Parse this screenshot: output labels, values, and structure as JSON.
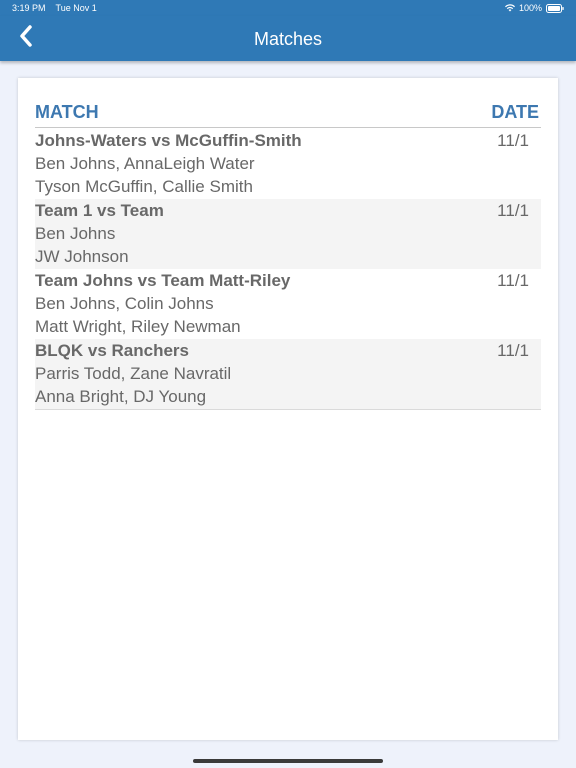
{
  "status_bar": {
    "time": "3:19 PM",
    "date": "Tue Nov 1",
    "battery": "100%",
    "icons": [
      "wifi-icon",
      "battery-icon"
    ]
  },
  "nav": {
    "title": "Matches",
    "back_icon": "chevron-left-icon"
  },
  "colors": {
    "nav_bg": "#2f79b6",
    "header_text": "#3d78b0",
    "row_text": "#686868",
    "alt_row_bg": "#f4f4f4",
    "page_bg": "#eef2fb"
  },
  "table": {
    "headers": {
      "match": "MATCH",
      "date": "DATE"
    },
    "rows": [
      {
        "title": "Johns-Waters vs McGuffin-Smith",
        "team1": "Ben Johns, AnnaLeigh Water",
        "team2": "Tyson McGuffin, Callie Smith",
        "date": "11/1"
      },
      {
        "title": "Team 1 vs Team",
        "team1": "Ben Johns",
        "team2": "JW Johnson",
        "date": "11/1"
      },
      {
        "title": "Team Johns vs Team Matt-Riley",
        "team1": "Ben Johns, Colin Johns",
        "team2": "Matt Wright, Riley Newman",
        "date": "11/1"
      },
      {
        "title": "BLQK vs Ranchers",
        "team1": "Parris Todd, Zane Navratil",
        "team2": "Anna Bright, DJ Young",
        "date": "11/1"
      }
    ]
  }
}
